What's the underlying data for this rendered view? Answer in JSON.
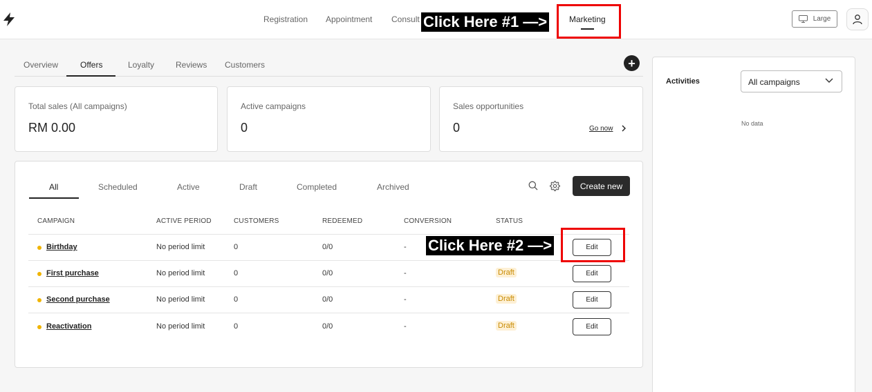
{
  "topnav": {
    "items": [
      "Registration",
      "Appointment",
      "Consult",
      "Marketing"
    ],
    "active": "Marketing"
  },
  "display_size": {
    "label": "Large",
    "icon": "monitor-icon"
  },
  "annotations": {
    "first": "Click Here #1 —>",
    "second": "Click Here #2 —>"
  },
  "subtabs": {
    "items": [
      "Overview",
      "Offers",
      "Loyalty",
      "Reviews",
      "Customers"
    ],
    "active": "Offers"
  },
  "stats": [
    {
      "label": "Total sales (All campaigns)",
      "value": "RM 0.00"
    },
    {
      "label": "Active campaigns",
      "value": "0"
    },
    {
      "label": "Sales opportunities",
      "value": "0",
      "link": "Go now"
    }
  ],
  "campaign_tabs": {
    "items": [
      "All",
      "Scheduled",
      "Active",
      "Draft",
      "Completed",
      "Archived"
    ],
    "active": "All"
  },
  "create_button": "Create new",
  "table": {
    "columns": [
      "CAMPAIGN",
      "ACTIVE PERIOD",
      "CUSTOMERS",
      "REDEEMED",
      "CONVERSION",
      "STATUS"
    ],
    "rows": [
      {
        "campaign": "Birthday",
        "period": "No period limit",
        "customers": "0",
        "redeemed": "0/0",
        "conversion": "-",
        "status": "",
        "action": "Edit"
      },
      {
        "campaign": "First purchase",
        "period": "No period limit",
        "customers": "0",
        "redeemed": "0/0",
        "conversion": "-",
        "status": "Draft",
        "action": "Edit"
      },
      {
        "campaign": "Second purchase",
        "period": "No period limit",
        "customers": "0",
        "redeemed": "0/0",
        "conversion": "-",
        "status": "Draft",
        "action": "Edit"
      },
      {
        "campaign": "Reactivation",
        "period": "No period limit",
        "customers": "0",
        "redeemed": "0/0",
        "conversion": "-",
        "status": "Draft",
        "action": "Edit"
      }
    ]
  },
  "activities": {
    "title": "Activities",
    "filter": "All campaigns",
    "empty": "No data"
  },
  "colors": {
    "accent": "#2b2b2b",
    "status_dot": "#f0b400",
    "draft_bg": "#fdf0d5",
    "draft_text": "#c88a00",
    "annotation_box": "#ee0000"
  }
}
